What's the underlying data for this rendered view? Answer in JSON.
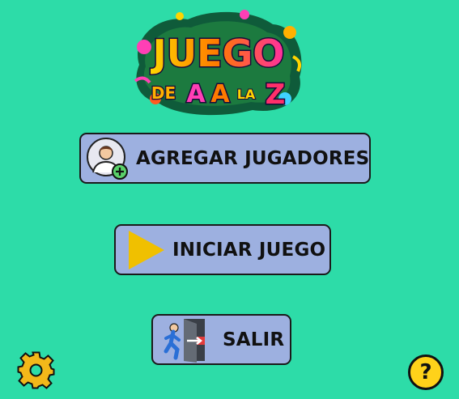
{
  "logo": {
    "line1": "JUEGO",
    "line2_prefix": "DE",
    "line2_a1": "A",
    "line2_a2": "A",
    "line2_la": "LA",
    "line2_z": "Z"
  },
  "menu": {
    "add_players_label": "AGREGAR JUGADORES",
    "start_game_label": "INICIAR JUEGO",
    "exit_label": "SALIR"
  },
  "help": {
    "label": "?"
  },
  "icons": {
    "add_players": "add-user-icon",
    "start_game": "play-icon",
    "exit": "exit-door-icon",
    "settings": "gear-icon"
  },
  "colors": {
    "background": "#2ddca8",
    "button": "#9db0e0",
    "play": "#f0c000",
    "gear": "#f2b81a",
    "help": "#ffd21a"
  }
}
